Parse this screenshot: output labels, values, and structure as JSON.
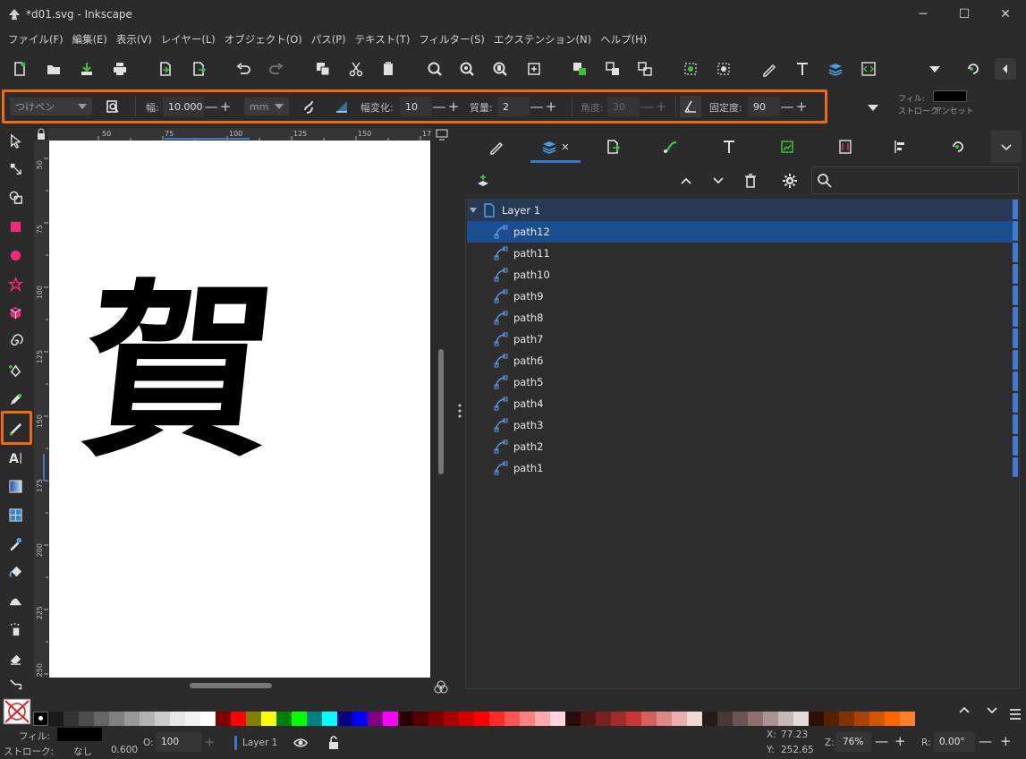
{
  "window": {
    "title": "*d01.svg - Inkscape",
    "minimize": "─",
    "maximize": "☐",
    "close": "✕"
  },
  "menu": [
    "ファイル(F)",
    "編集(E)",
    "表示(V)",
    "レイヤー(L)",
    "オブジェクト(O)",
    "パス(P)",
    "テキスト(T)",
    "フィルター(S)",
    "エクステンション(N)",
    "ヘルプ(H)"
  ],
  "tool_controls": {
    "preset": "つけペン",
    "width_label": "幅:",
    "width_value": "10.000",
    "unit": "mm",
    "thinning_label": "幅変化:",
    "thinning_value": "10",
    "mass_label": "質量:",
    "mass_value": "2",
    "angle_label": "角度:",
    "angle_value": "30",
    "fixation_label": "固定度:",
    "fixation_value": "90",
    "minus": "—",
    "plus": "+"
  },
  "style_indicator": {
    "fill_label": "フィル:",
    "stroke_label": "ストローク:",
    "stroke_value": "アンセット",
    "fill_color": "#000000"
  },
  "ruler": {
    "top": [
      "50",
      "75",
      "100",
      "125",
      "150",
      "17"
    ],
    "left": [
      "50",
      "75",
      "100",
      "125",
      "150",
      "175",
      "200",
      "225",
      "250"
    ]
  },
  "canvas_text": "賀",
  "layers_panel": {
    "layer_name": "Layer 1",
    "paths": [
      "path12",
      "path11",
      "path10",
      "path9",
      "path8",
      "path7",
      "path6",
      "path5",
      "path4",
      "path3",
      "path2",
      "path1"
    ],
    "selected": "path12",
    "tab_close": "✕"
  },
  "palette": [
    "#000000",
    "#1a1a1a",
    "#333333",
    "#4d4d4d",
    "#666666",
    "#808080",
    "#999999",
    "#b3b3b3",
    "#cccccc",
    "#e6e6e6",
    "#f2f2f2",
    "#ffffff",
    "#800000",
    "#ff0000",
    "#808000",
    "#ffff00",
    "#008000",
    "#00ff00",
    "#008080",
    "#00ffff",
    "#000080",
    "#0000ff",
    "#800080",
    "#ff00ff",
    "#2b0000",
    "#550000",
    "#800000",
    "#aa0000",
    "#d40000",
    "#ff0000",
    "#ff2a2a",
    "#ff5555",
    "#ff8080",
    "#ffaaaa",
    "#ffd5d5",
    "#280b0b",
    "#501616",
    "#782121",
    "#a02c2c",
    "#c83737",
    "#d35f5f",
    "#de8787",
    "#e9afaf",
    "#f4d7d7",
    "#241c1c",
    "#483737",
    "#6c5353",
    "#916f6f",
    "#ac9393",
    "#c8b7b7",
    "#e3dbdb",
    "#2b1100",
    "#552200",
    "#803300",
    "#aa4400",
    "#d45500",
    "#ff6600",
    "#ff7f2a"
  ],
  "status": {
    "fill_label": "フィル:",
    "stroke_label": "ストローク:",
    "stroke_value": "なし",
    "stroke_width": "0.600",
    "opacity_label": "O:",
    "opacity_value": "100",
    "layer": "Layer 1",
    "x_label": "X:",
    "x_value": "77.23",
    "y_label": "Y:",
    "y_value": "252.65",
    "zoom_label": "Z:",
    "zoom_value": "76%",
    "rotate_label": "R:",
    "rotate_value": "0.00°"
  }
}
